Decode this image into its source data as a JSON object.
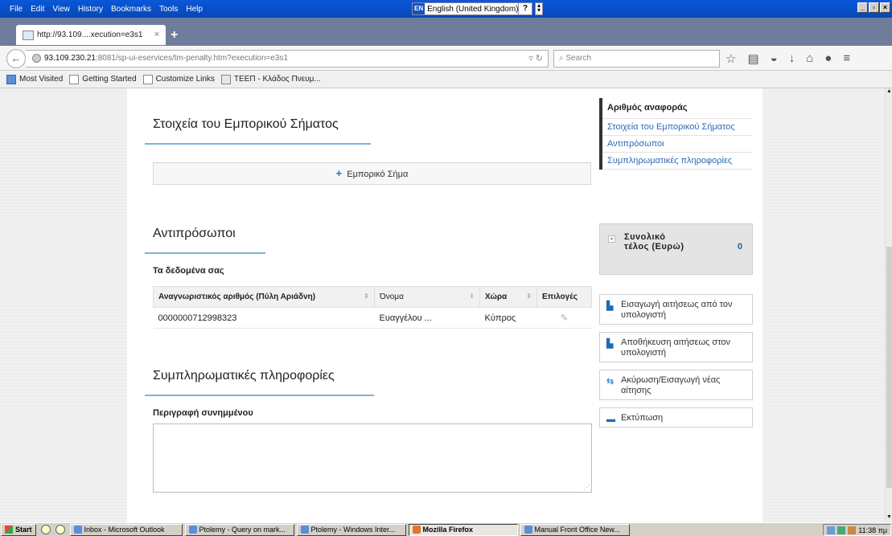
{
  "menubar": {
    "items": [
      "File",
      "Edit",
      "View",
      "History",
      "Bookmarks",
      "Tools",
      "Help"
    ],
    "language_code": "EN",
    "language_label": "English (United Kingdom)",
    "help_glyph": "?"
  },
  "browser": {
    "tab_title": "http://93.109....xecution=e3s1",
    "tab_close": "×",
    "new_tab": "+",
    "url_host": "93.109.230.21",
    "url_path": ":8081/sp-ui-eservices/tm-penalty.htm?execution=e3s1",
    "search_placeholder": "Search",
    "bookmarks": [
      "Most Visited",
      "Getting Started",
      "Customize Links",
      "ΤΕΕΠ - Κλάδος Πνευμ..."
    ]
  },
  "main": {
    "trademark_section_title": "Στοιχεία του Εμπορικού Σήματος",
    "add_trademark_label": "Εμπορικό Σήμα",
    "representatives_section_title": "Αντιπρόσωποι",
    "your_data_label": "Τα δεδομένα σας",
    "table": {
      "headers": [
        "Αναγνωριστικός αριθμός (Πύλη Αριάδνη)",
        "Όνομα",
        "Χώρα",
        "Επιλογές"
      ],
      "rows": [
        {
          "id": "0000000712998323",
          "name": "Ευαγγέλου ...",
          "country": "Κύπρος"
        }
      ]
    },
    "additional_section_title": "Συμπληρωματικές πληροφορίες",
    "attachment_description_label": "Περιγραφή συνημμένου",
    "attachment_description_value": ""
  },
  "sidebar": {
    "nav_title": "Αριθμός αναφοράς",
    "nav_links": [
      "Στοιχεία του Εμπορικού Σήματος",
      "Αντιπρόσωποι",
      "Συμπληρωματικές πληροφορίες"
    ],
    "fee_label": "Συνολικό τέλος (Ευρώ)",
    "fee_value": "0",
    "actions": {
      "import": "Εισαγωγή αιτήσεως από τον υπολογιστή",
      "save": "Αποθήκευση αιτήσεως στον υπολογιστή",
      "cancel": "Ακύρωση/Εισαγωγή νέας αίτησης",
      "print": "Εκτύπωση"
    }
  },
  "taskbar": {
    "start_label": "Start",
    "tasks": [
      "Inbox - Microsoft Outlook",
      "Ptolemy - Query on mark...",
      "Ptolemy - Windows Inter...",
      "Mozilla Firefox",
      "Manual Front Office New..."
    ],
    "clock": "11:38 πμ"
  },
  "colors": {
    "accent": "#2a6bb4",
    "section_underline": "#7ab4d8",
    "titlebar": "#0a58d8"
  }
}
